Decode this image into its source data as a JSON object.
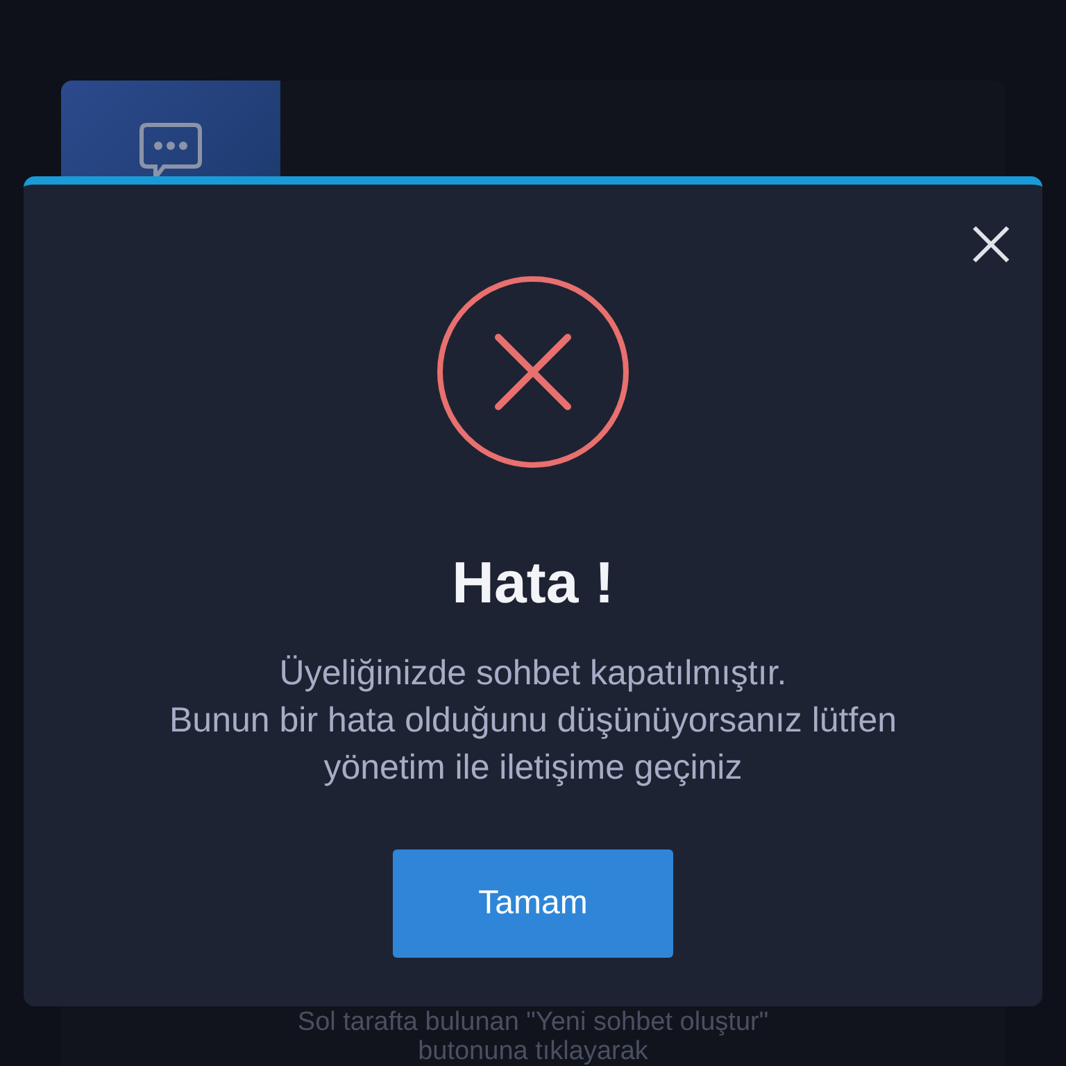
{
  "background": {
    "hint_lines": [
      "Sol tarafta bulunan \"Yeni sohbet oluştur\"",
      "butonuna tıklayarak"
    ]
  },
  "dialog": {
    "title": "Hata !",
    "message_lines": [
      "Üyeliğinizde sohbet kapatılmıştır.",
      "Bunun bir hata olduğunu düşünüyorsanız lütfen",
      "yönetim ile iletişime geçiniz"
    ],
    "kind": "error",
    "button": "Tamam"
  }
}
